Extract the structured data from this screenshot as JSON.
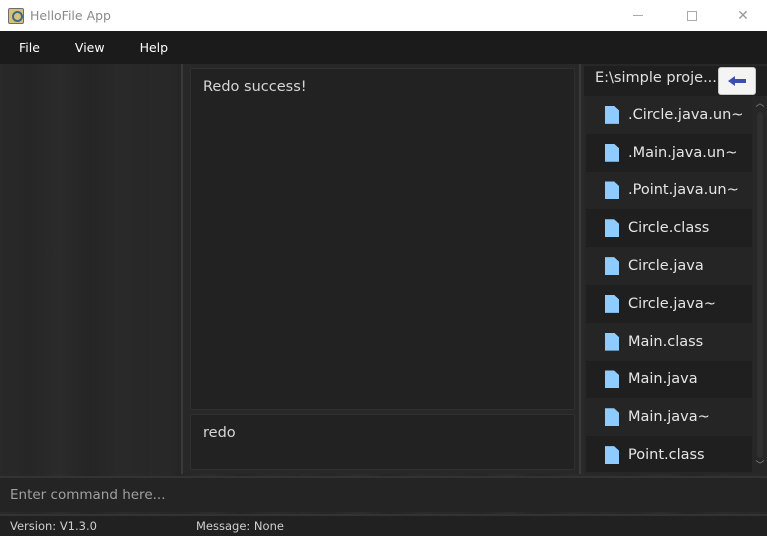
{
  "window": {
    "title": "HelloFile App",
    "icon": "app-magnifier-icon",
    "controls": {
      "minimize": "minimize-icon",
      "maximize": "maximize-icon",
      "close": "close-icon"
    }
  },
  "menubar": {
    "items": [
      {
        "label": "File"
      },
      {
        "label": "View"
      },
      {
        "label": "Help"
      }
    ]
  },
  "result_display": {
    "text": "Redo success!"
  },
  "history_display": {
    "text": "redo"
  },
  "file_browser": {
    "path": "E:\\simple proje...",
    "back_button_icon": "arrow-left-icon",
    "files": [
      {
        "name": ".Circle.java.un~",
        "icon": "file-icon"
      },
      {
        "name": ".Main.java.un~",
        "icon": "file-icon"
      },
      {
        "name": ".Point.java.un~",
        "icon": "file-icon"
      },
      {
        "name": "Circle.class",
        "icon": "file-icon"
      },
      {
        "name": "Circle.java",
        "icon": "file-icon"
      },
      {
        "name": "Circle.java~",
        "icon": "file-icon"
      },
      {
        "name": "Main.class",
        "icon": "file-icon"
      },
      {
        "name": "Main.java",
        "icon": "file-icon"
      },
      {
        "name": "Main.java~",
        "icon": "file-icon"
      },
      {
        "name": "Point.class",
        "icon": "file-icon"
      }
    ],
    "accent_color": "#8ecbff"
  },
  "command_box": {
    "value": "",
    "placeholder": "Enter command here..."
  },
  "statusbar": {
    "version": "Version:  V1.3.0",
    "message": "Message:  None"
  }
}
